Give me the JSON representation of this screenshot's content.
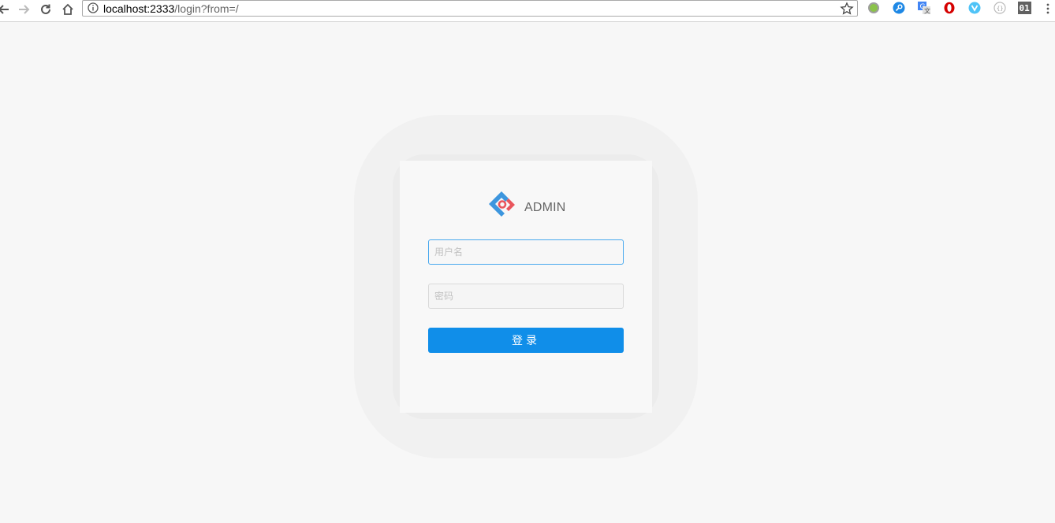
{
  "browser": {
    "url_host": "localhost:2333",
    "url_path": "/login?from=/"
  },
  "login": {
    "brand": "ADMIN",
    "username_placeholder": "用户名",
    "password_placeholder": "密码",
    "submit_label": "登录"
  },
  "colors": {
    "primary": "#108ee9",
    "logo_blue": "#3d96de",
    "logo_red": "#e9555c"
  }
}
